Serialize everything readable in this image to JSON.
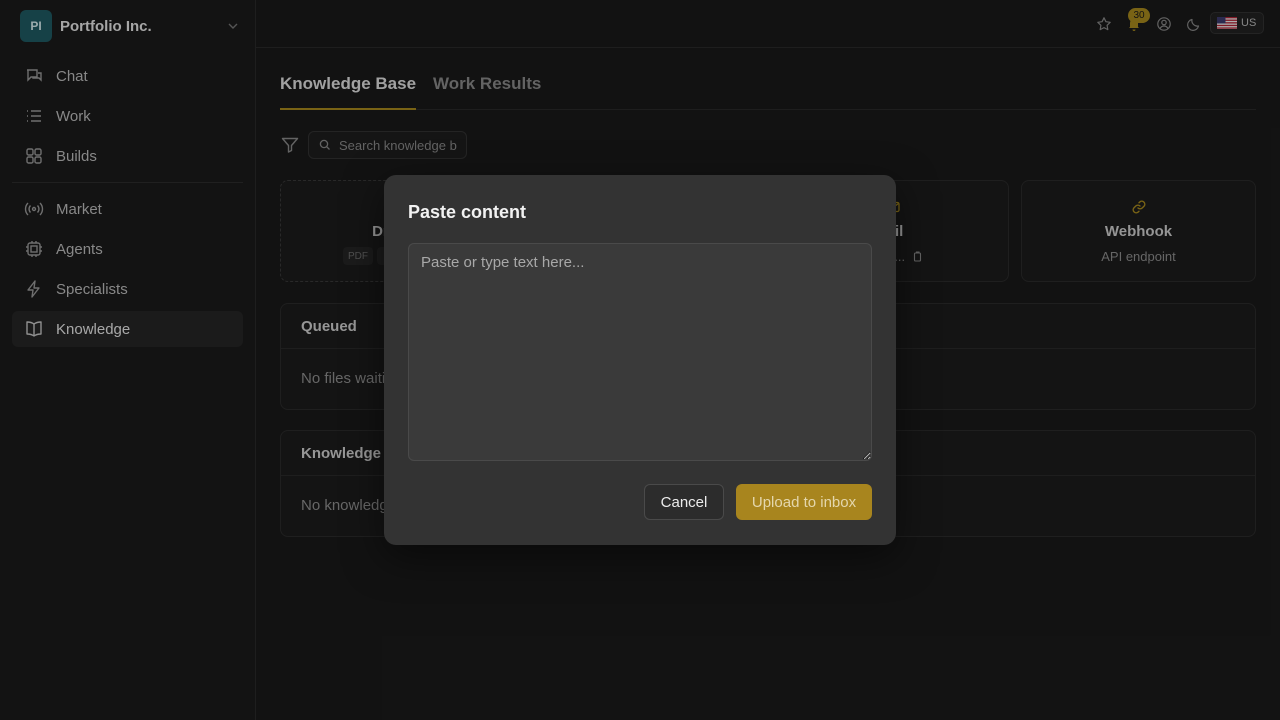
{
  "org": {
    "initials": "PI",
    "name": "Portfolio Inc."
  },
  "sidebar": {
    "items": [
      {
        "label": "Chat",
        "icon": "chat-icon"
      },
      {
        "label": "Work",
        "icon": "list-icon"
      },
      {
        "label": "Builds",
        "icon": "grid-icon"
      },
      {
        "label": "Market",
        "icon": "broadcast-icon"
      },
      {
        "label": "Agents",
        "icon": "chip-icon"
      },
      {
        "label": "Specialists",
        "icon": "bolt-icon"
      },
      {
        "label": "Knowledge",
        "icon": "book-icon"
      }
    ],
    "active": "Knowledge"
  },
  "topbar": {
    "notifications": "30",
    "locale": "US"
  },
  "main": {
    "tabs": [
      {
        "label": "Knowledge Base"
      },
      {
        "label": "Work Results"
      }
    ],
    "search_placeholder": "Search knowledge base",
    "sources": {
      "drop_title": "Dro",
      "drop_chip": "PDF",
      "email_title": "ail",
      "email_sub": "nc@...",
      "webhook_title": "Webhook",
      "webhook_sub": "API endpoint"
    },
    "queued": {
      "title": "Queued",
      "empty": "No files waiti"
    },
    "knowledge": {
      "title": "Knowledge I",
      "empty": "No knowledg"
    }
  },
  "modal": {
    "title": "Paste content",
    "placeholder": "Paste or type text here...",
    "cancel": "Cancel",
    "submit": "Upload to inbox"
  },
  "colors": {
    "accent": "#a8851e",
    "avatar": "#1f5a63",
    "background": "#1a1a1a",
    "modal": "#333333"
  }
}
